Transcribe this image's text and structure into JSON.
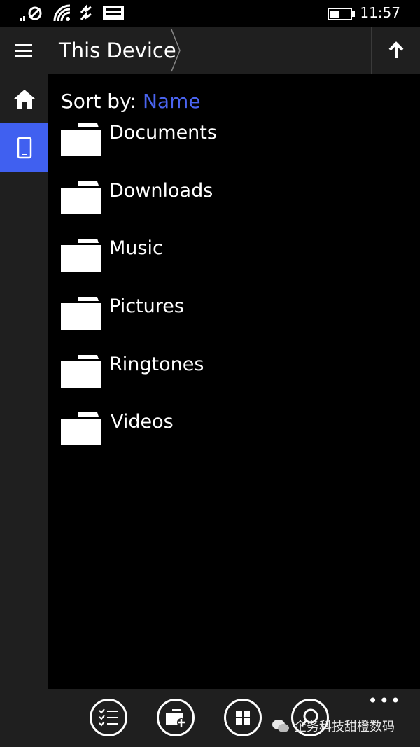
{
  "status": {
    "time": "11:57",
    "icons": [
      "no-sim-icon",
      "wifi-icon",
      "data-icon",
      "message-icon",
      "battery-icon"
    ]
  },
  "header": {
    "menu_icon": "hamburger-icon",
    "breadcrumb": "This Device",
    "up_icon": "arrow-up-icon"
  },
  "nav": {
    "items": [
      {
        "icon": "home-icon",
        "active": false
      },
      {
        "icon": "phone-icon",
        "active": true
      }
    ]
  },
  "sort": {
    "label": "Sort by:",
    "value": "Name"
  },
  "folders": [
    {
      "name": "Documents"
    },
    {
      "name": "Downloads"
    },
    {
      "name": "Music"
    },
    {
      "name": "Pictures"
    },
    {
      "name": "Ringtones"
    },
    {
      "name": "Videos"
    }
  ],
  "appbar": {
    "buttons": [
      "select-icon",
      "new-folder-icon",
      "view-icon",
      "search-icon"
    ],
    "more": "•••"
  },
  "watermark": {
    "text": "企务科技甜橙数码"
  },
  "colors": {
    "accent": "#4060f0",
    "chrome": "#1f1f1f",
    "background": "#000000"
  }
}
